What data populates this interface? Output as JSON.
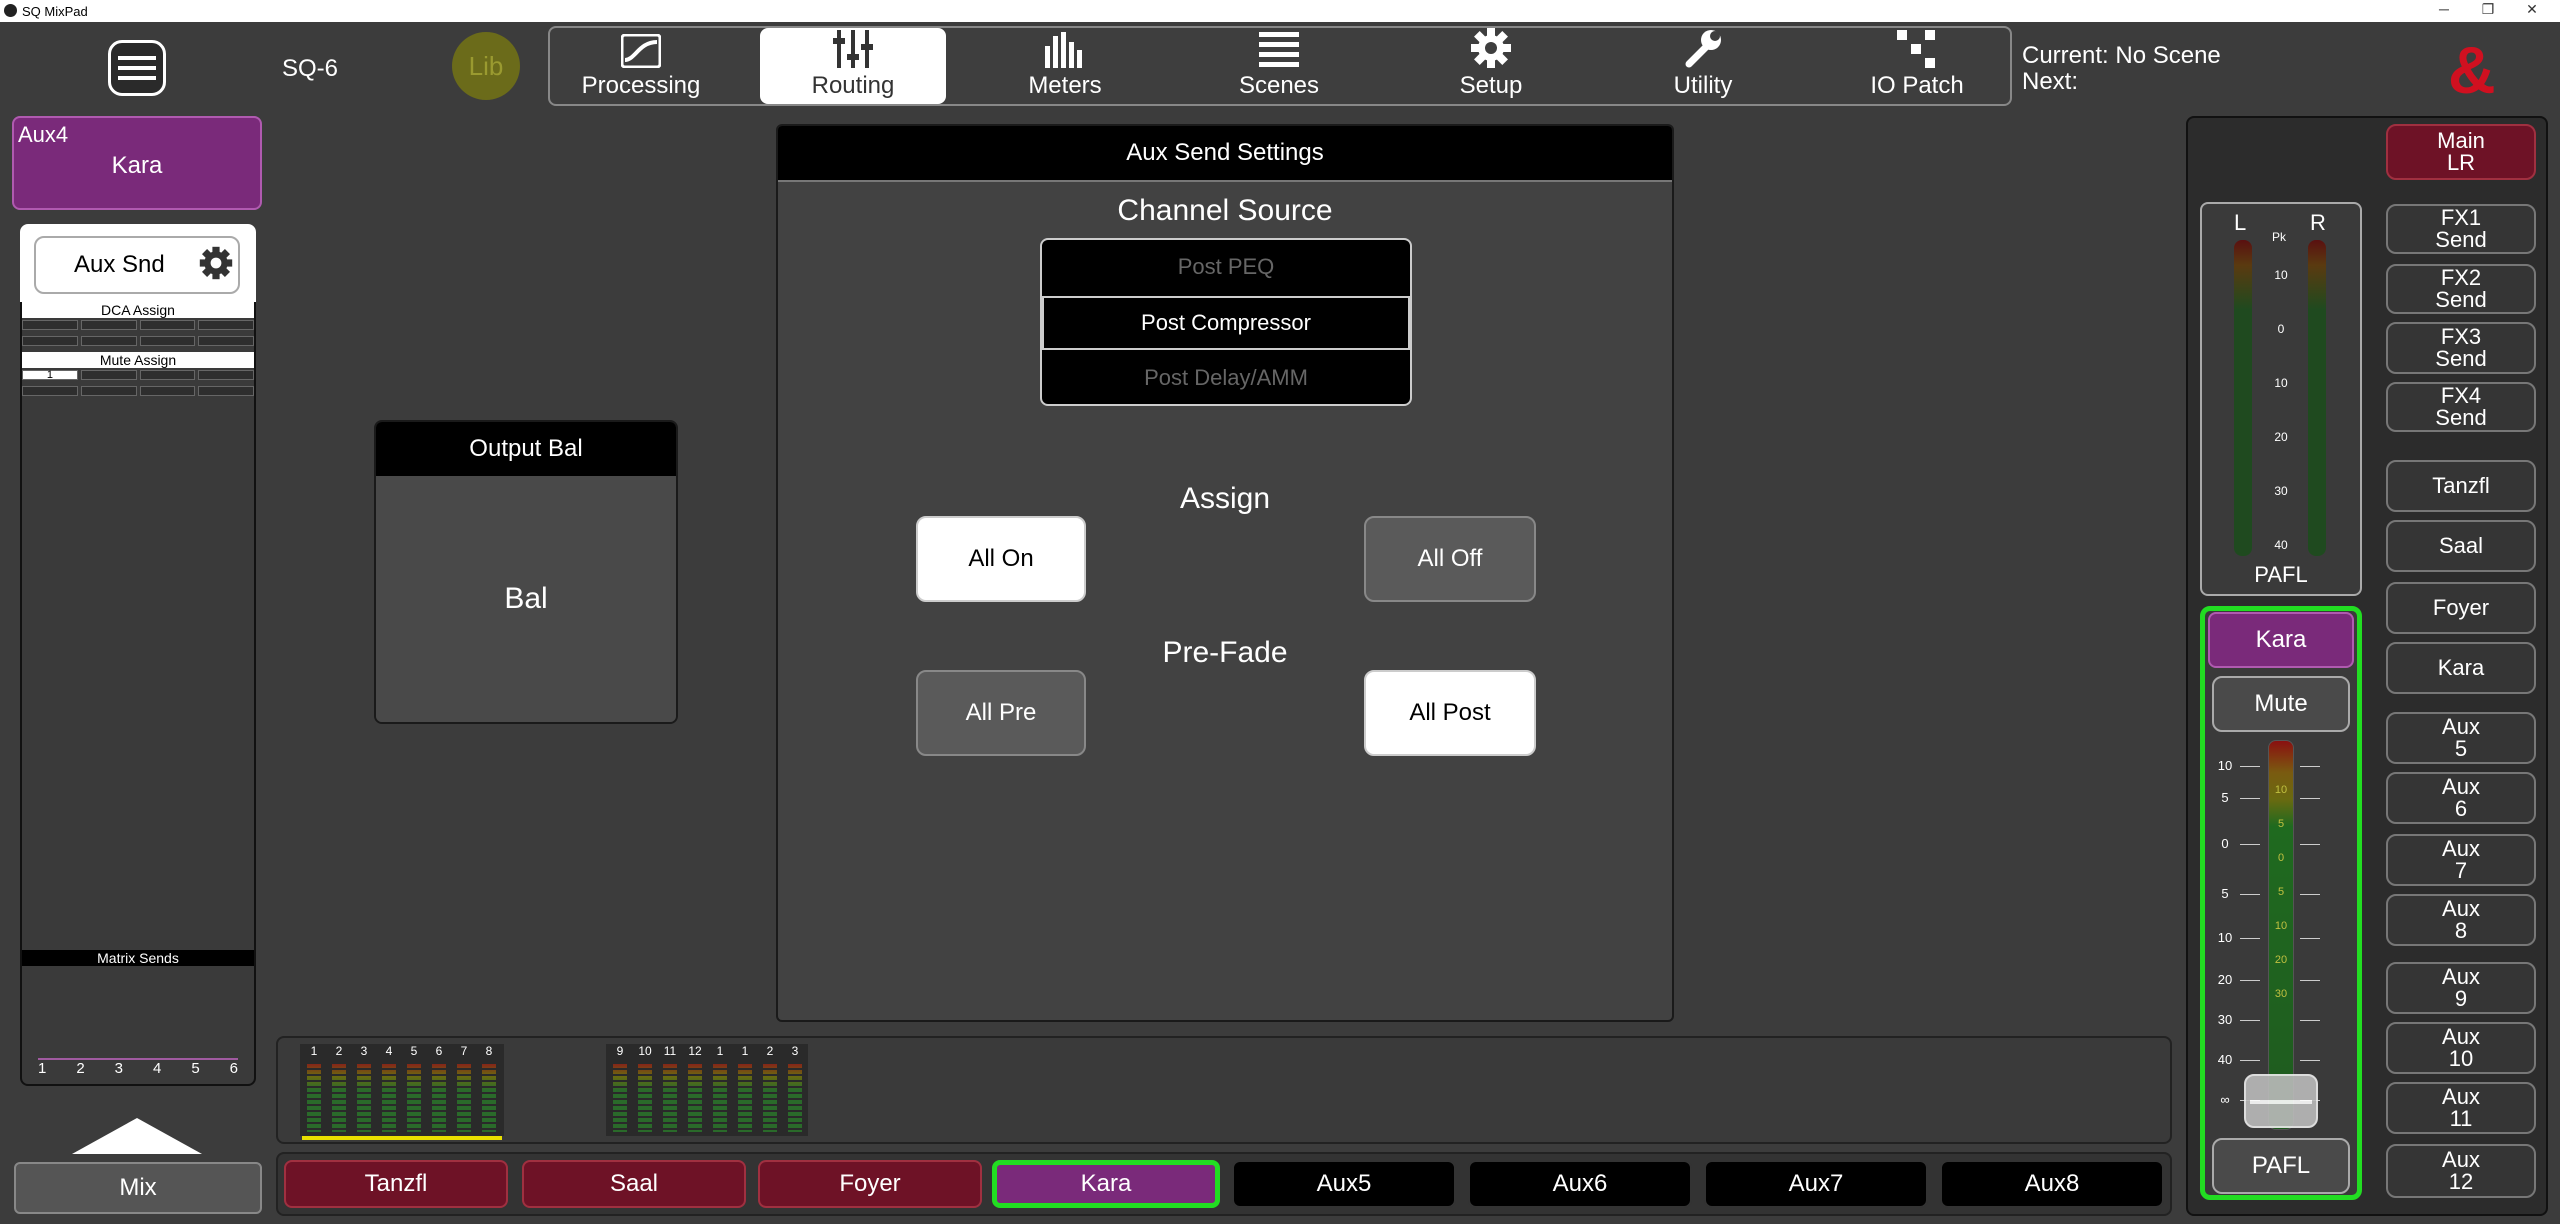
{
  "window": {
    "title": "SQ MixPad",
    "minimize": "─",
    "restore": "❐",
    "close": "✕"
  },
  "header": {
    "device": "SQ-6",
    "lib_label": "Lib",
    "tabs": [
      {
        "label": "Processing",
        "icon": "processing-icon"
      },
      {
        "label": "Routing",
        "icon": "routing-icon"
      },
      {
        "label": "Meters",
        "icon": "meters-icon"
      },
      {
        "label": "Scenes",
        "icon": "scenes-icon"
      },
      {
        "label": "Setup",
        "icon": "gear-icon"
      },
      {
        "label": "Utility",
        "icon": "wrench-icon"
      },
      {
        "label": "IO Patch",
        "icon": "io-patch-icon"
      }
    ],
    "active_tab": "Routing",
    "scene_current": "Current: No Scene",
    "scene_next": "Next:",
    "brand_logo": "&"
  },
  "left": {
    "channel_type": "Aux4",
    "channel_name": "Kara",
    "aux_snd_label": "Aux Snd",
    "dca_assign": "DCA Assign",
    "mute_assign": "Mute Assign",
    "mute_group_1": "1",
    "matrix_sends": "Matrix Sends",
    "matrix_numbers": [
      "1",
      "2",
      "3",
      "4",
      "5",
      "6"
    ],
    "mix_label": "Mix"
  },
  "output_bal": {
    "header": "Output Bal",
    "label": "Bal"
  },
  "aux_send": {
    "header": "Aux Send Settings",
    "channel_source_title": "Channel Source",
    "sources": [
      "Post PEQ",
      "Post Compressor",
      "Post Delay/AMM"
    ],
    "selected_source": "Post Compressor",
    "assign_title": "Assign",
    "all_on": "All On",
    "all_off": "All Off",
    "prefade_title": "Pre-Fade",
    "all_pre": "All Pre",
    "all_post": "All Post"
  },
  "meters_strip": {
    "group1": [
      "1",
      "2",
      "3",
      "4",
      "5",
      "6",
      "7",
      "8"
    ],
    "group2": [
      "9",
      "10",
      "11",
      "12",
      "1",
      "1",
      "2",
      "3"
    ]
  },
  "bottom_mixes": [
    {
      "label": "Tanzfl",
      "style": "red"
    },
    {
      "label": "Saal",
      "style": "red"
    },
    {
      "label": "Foyer",
      "style": "red"
    },
    {
      "label": "Kara",
      "style": "selected"
    },
    {
      "label": "Aux5",
      "style": "black"
    },
    {
      "label": "Aux6",
      "style": "black"
    },
    {
      "label": "Aux7",
      "style": "black"
    },
    {
      "label": "Aux8",
      "style": "black"
    }
  ],
  "right": {
    "meter": {
      "l": "L",
      "r": "R",
      "pk": "Pk",
      "ticks": [
        "10",
        "0",
        "10",
        "20",
        "30",
        "40"
      ],
      "pafl": "PAFL"
    },
    "channel": {
      "name": "Kara",
      "mute": "Mute",
      "pafl": "PAFL",
      "scale_left": [
        "10",
        "5",
        "0",
        "5",
        "10",
        "20",
        "30",
        "40",
        "∞"
      ],
      "scale_meter": [
        "10",
        "5",
        "0",
        "5",
        "10",
        "20",
        "30"
      ]
    },
    "buttons": [
      {
        "label": "Main LR",
        "style": "red"
      },
      {
        "label": "FX1 Send"
      },
      {
        "label": "FX2 Send"
      },
      {
        "label": "FX3 Send"
      },
      {
        "label": "FX4 Send"
      },
      {
        "label": "Tanzfl"
      },
      {
        "label": "Saal"
      },
      {
        "label": "Foyer"
      },
      {
        "label": "Kara"
      },
      {
        "label": "Aux 5"
      },
      {
        "label": "Aux 6"
      },
      {
        "label": "Aux 7"
      },
      {
        "label": "Aux 8"
      },
      {
        "label": "Aux 9"
      },
      {
        "label": "Aux 10"
      },
      {
        "label": "Aux 11"
      },
      {
        "label": "Aux 12"
      }
    ]
  },
  "colors": {
    "accent_red": "#6e1226",
    "aux_purple": "#7a2a7a",
    "select_green": "#22dd22",
    "lib_olive": "#6b6b1a"
  }
}
